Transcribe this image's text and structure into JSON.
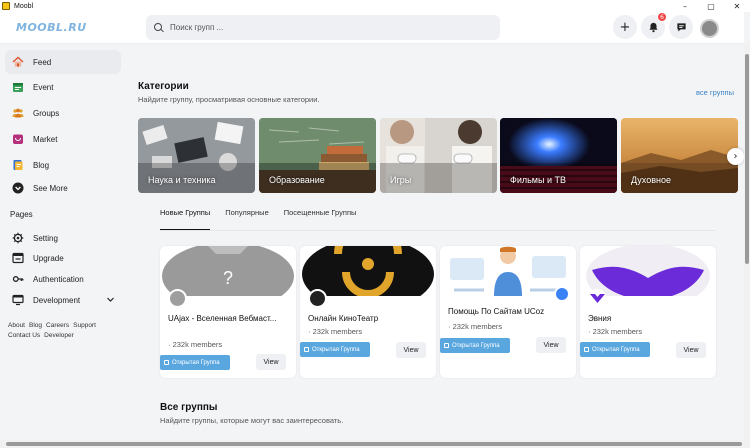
{
  "window": {
    "title": "Moobl",
    "minimize": "–",
    "maximize": "▢",
    "close": "✕"
  },
  "header": {
    "logo": "MOOBL.RU",
    "search_placeholder": "Поиск групп ...",
    "notification_count": "6",
    "add_icon": "plus-icon",
    "bell_icon": "bell-icon",
    "chat_icon": "chat-icon"
  },
  "sidebar": {
    "items": [
      {
        "label": "Feed",
        "icon": "home-icon"
      },
      {
        "label": "Event",
        "icon": "calendar-icon"
      },
      {
        "label": "Groups",
        "icon": "people-icon"
      },
      {
        "label": "Market",
        "icon": "shop-icon"
      },
      {
        "label": "Blog",
        "icon": "blog-icon"
      },
      {
        "label": "See More",
        "icon": "chevron-down-icon"
      }
    ],
    "pages_label": "Pages",
    "pages": [
      {
        "label": "Setting",
        "icon": "gear-icon"
      },
      {
        "label": "Upgrade",
        "icon": "upgrade-icon"
      },
      {
        "label": "Authentication",
        "icon": "key-icon"
      },
      {
        "label": "Development",
        "icon": "monitor-icon"
      }
    ],
    "footer_links": [
      "About",
      "Blog",
      "Careers",
      "Support",
      "Contact Us",
      "Developer"
    ]
  },
  "categories": {
    "title": "Категории",
    "subtitle": "Найдите группу, просматривая основные категории.",
    "all_link": "все группы",
    "items": [
      {
        "label": "Наука и техника"
      },
      {
        "label": "Образование"
      },
      {
        "label": "Игры"
      },
      {
        "label": "Фильмы и ТВ"
      },
      {
        "label": "Духовное"
      }
    ]
  },
  "tabs": [
    "Новые Группы",
    "Популярные",
    "Посещенные Группы"
  ],
  "groups": [
    {
      "name": "UAjax - Вселенная Вебмаст...",
      "members": "232k members",
      "open_label": "Открытая Группа",
      "view_label": "View"
    },
    {
      "name": "Онлайн КиноТеатр",
      "members": "232k members",
      "open_label": "Открытая Группа",
      "view_label": "View"
    },
    {
      "name": "Помощь По Сайтам UCoz",
      "members": "232k members",
      "open_label": "Открытая Группа",
      "view_label": "View"
    },
    {
      "name": "Эвния",
      "members": "232k members",
      "open_label": "Открытая Группа",
      "view_label": "View"
    }
  ],
  "all_groups": {
    "title": "Все группы",
    "subtitle": "Найдите группы, которые могут вас заинтересовать."
  },
  "colors": {
    "accent": "#5aa7df",
    "link": "#3b82c4",
    "badge": "#ef4444",
    "logo": "#7fb3e0"
  }
}
